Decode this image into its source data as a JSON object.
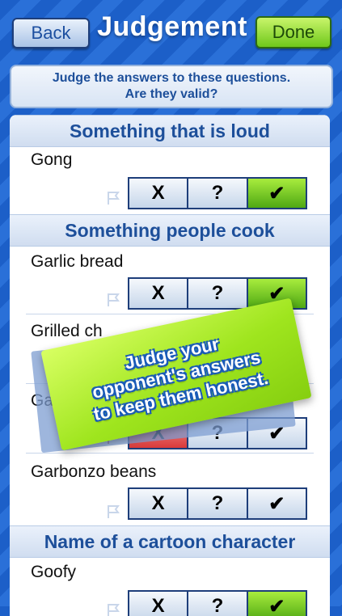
{
  "header": {
    "back_label": "Back",
    "title": "Judgement",
    "done_label": "Done"
  },
  "instructions": {
    "line1": "Judge the answers to these questions.",
    "line2": "Are they valid?"
  },
  "vote_labels": {
    "invalid": "X",
    "unsure": "?",
    "valid": "✔"
  },
  "categories": [
    {
      "title": "Something that is loud",
      "answers": [
        {
          "text": "Gong",
          "vote": "valid"
        }
      ]
    },
    {
      "title": "Something people cook",
      "answers": [
        {
          "text": "Garlic bread",
          "vote": "valid"
        },
        {
          "text": "Grilled ch",
          "vote": "none"
        },
        {
          "text": "Ga",
          "vote": "invalid"
        },
        {
          "text": "Garbonzo beans",
          "vote": "none"
        }
      ]
    },
    {
      "title": "Name of a cartoon character",
      "answers": [
        {
          "text": "Goofy",
          "vote": "valid"
        }
      ]
    }
  ],
  "promo": {
    "line1": "Judge your",
    "line2": "opponent's answers",
    "line3": "to keep them honest."
  },
  "colors": {
    "accent": "#1d4f9a",
    "valid": "#7ed321",
    "invalid": "#e05050"
  }
}
